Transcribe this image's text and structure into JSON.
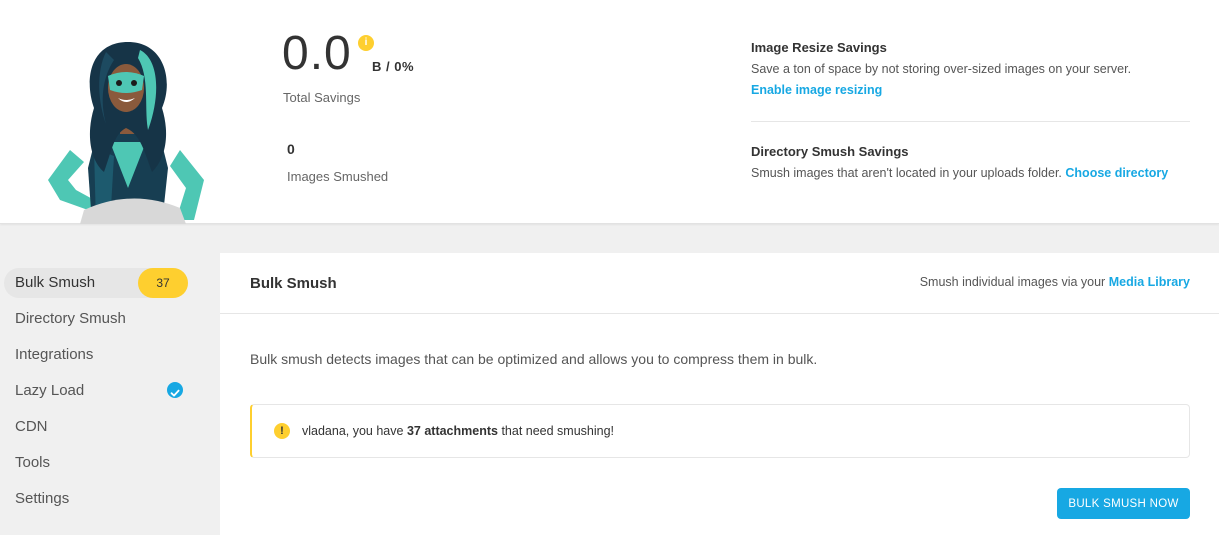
{
  "summary": {
    "total_value": "0.0",
    "info_icon_glyph": "i",
    "unit_and_percent": "B / 0%",
    "total_label": "Total Savings",
    "smushed_count": "0",
    "smushed_label": "Images Smushed",
    "resize": {
      "title": "Image Resize Savings",
      "description": "Save a ton of space by not storing over-sized images on your server.",
      "link": "Enable image resizing"
    },
    "directory": {
      "title": "Directory Smush Savings",
      "description": "Smush images that aren't located in your uploads folder.",
      "link": "Choose directory"
    }
  },
  "sidebar": {
    "items": [
      {
        "label": "Bulk Smush",
        "badge": "37"
      },
      {
        "label": "Directory Smush"
      },
      {
        "label": "Integrations"
      },
      {
        "label": "Lazy Load",
        "icon": "check-circle-icon"
      },
      {
        "label": "CDN"
      },
      {
        "label": "Tools"
      },
      {
        "label": "Settings"
      }
    ]
  },
  "panel": {
    "title": "Bulk Smush",
    "hint_text": "Smush individual images via your",
    "hint_link": "Media Library",
    "description": "Bulk smush detects images that can be optimized and allows you to compress them in bulk.",
    "notice": {
      "icon_glyph": "!",
      "prefix": "vladana, you have",
      "count_text": "37 attachments",
      "suffix": "that need smushing!"
    },
    "button_label": "BULK SMUSH NOW"
  },
  "colors": {
    "accent_blue": "#17a8e3",
    "warning_yellow": "#fecf2f"
  }
}
